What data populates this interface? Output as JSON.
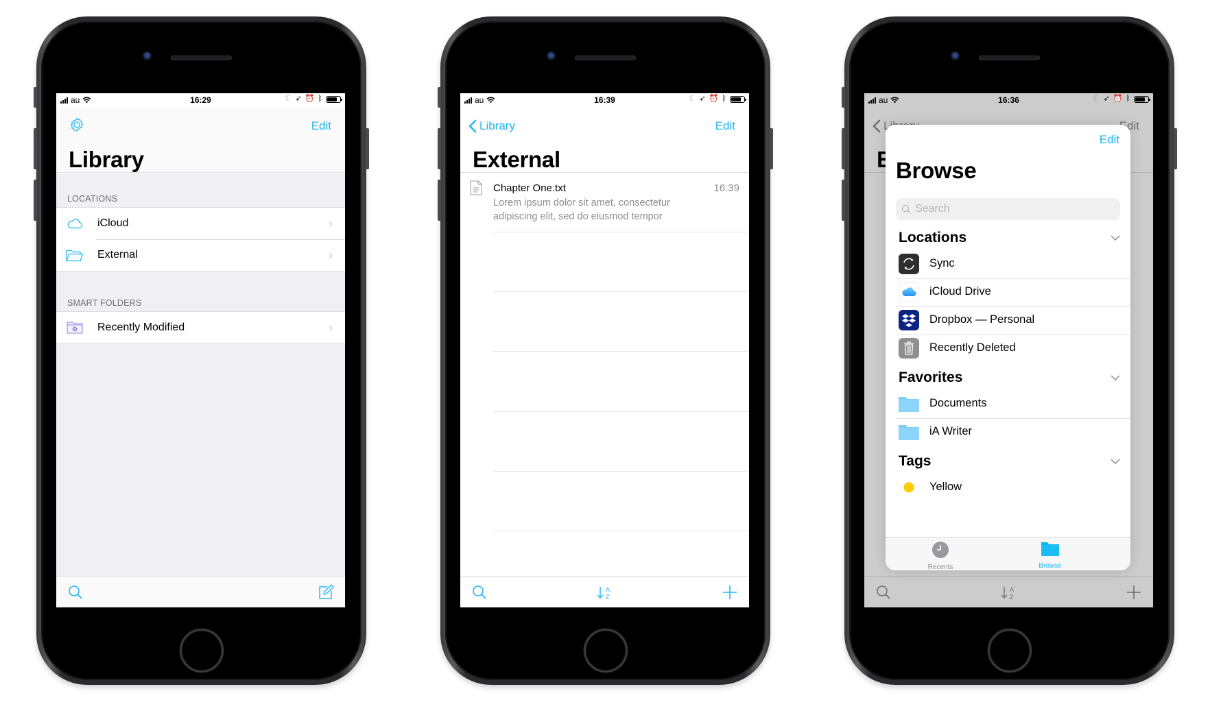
{
  "colors": {
    "accent": "#1fb6f0",
    "grouped_background": "#efeff4",
    "secondary_text": "#8e8e93",
    "section_header": "#6d6d72",
    "dropbox_blue": "#0d2481",
    "sync_dark": "#2e2e30",
    "trash_gray": "#8e8e93",
    "folder_blue": "#7ecff5",
    "tag_yellow": "#ffcc00"
  },
  "phones": [
    {
      "status": {
        "carrier": "au",
        "time": "16:29"
      },
      "nav": {
        "edit_label": "Edit",
        "settings_icon": "gear-icon"
      },
      "title": "Library",
      "sections": [
        {
          "header": "LOCATIONS",
          "items": [
            {
              "label": "iCloud",
              "icon": "cloud-outline-icon"
            },
            {
              "label": "External",
              "icon": "folder-open-icon"
            }
          ]
        },
        {
          "header": "SMART FOLDERS",
          "items": [
            {
              "label": "Recently Modified",
              "icon": "smart-folder-gear-icon"
            }
          ]
        }
      ],
      "toolbar": {
        "left_icon": "search-icon",
        "right_icon": "compose-icon"
      }
    },
    {
      "status": {
        "carrier": "au",
        "time": "16:39"
      },
      "nav": {
        "back_label": "Library",
        "edit_label": "Edit"
      },
      "title": "External",
      "files": [
        {
          "name": "Chapter One.txt",
          "time": "16:39",
          "preview": "Lorem ipsum dolor sit amet, consectetur adipiscing elit, sed do eiusmod tempor"
        }
      ],
      "toolbar": {
        "left_icon": "search-icon",
        "center_icon": "sort-az-icon",
        "right_icon": "plus-icon"
      }
    },
    {
      "status": {
        "carrier": "au",
        "time": "16:36"
      },
      "background_nav": {
        "back_label": "Library",
        "edit_label": "Edit",
        "title_initial": "E"
      },
      "sheet": {
        "edit_label": "Edit",
        "title": "Browse",
        "search_placeholder": "Search",
        "sections": [
          {
            "header": "Locations",
            "items": [
              {
                "label": "Sync",
                "icon": "sync-icon"
              },
              {
                "label": "iCloud Drive",
                "icon": "icloud-drive-icon"
              },
              {
                "label": "Dropbox — Personal",
                "icon": "dropbox-icon"
              },
              {
                "label": "Recently Deleted",
                "icon": "trash-icon"
              }
            ]
          },
          {
            "header": "Favorites",
            "items": [
              {
                "label": "Documents",
                "icon": "folder-icon"
              },
              {
                "label": "iA Writer",
                "icon": "folder-icon"
              }
            ]
          },
          {
            "header": "Tags",
            "items": [
              {
                "label": "Yellow",
                "icon": "yellow-tag-dot-icon"
              }
            ]
          }
        ],
        "tabs": [
          {
            "label": "Recents",
            "icon": "clock-icon",
            "selected": false
          },
          {
            "label": "Browse",
            "icon": "folder-icon",
            "selected": true
          }
        ]
      },
      "toolbar": {
        "left_icon": "search-icon",
        "center_icon": "sort-az-icon",
        "right_icon": "plus-icon"
      }
    }
  ]
}
